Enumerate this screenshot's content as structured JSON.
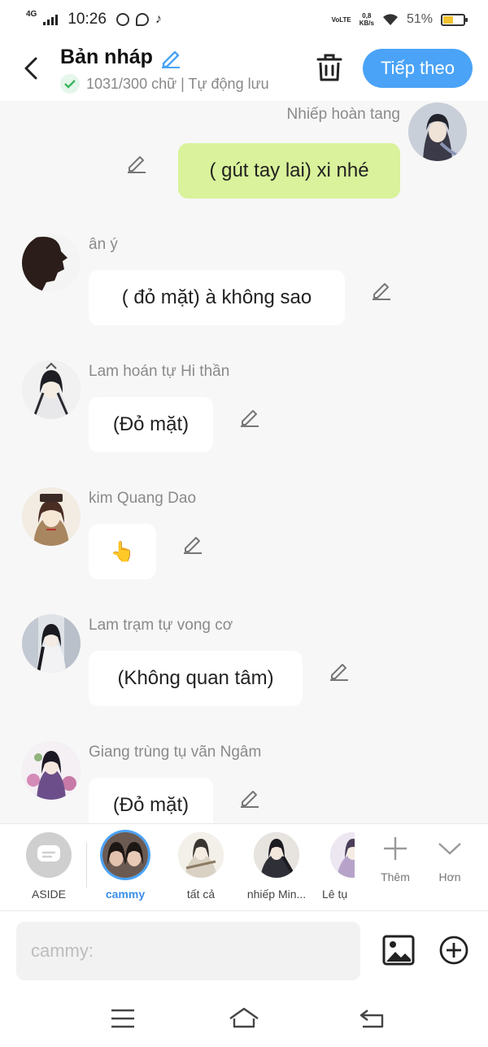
{
  "status_bar": {
    "network": "4G",
    "time": "10:26",
    "volte": "VoLTE",
    "speed_value": "0,8",
    "speed_unit": "KB/s",
    "battery": "51%",
    "battery_level": 0.51
  },
  "header": {
    "title": "Bản nháp",
    "subtitle": "1031/300 chữ | Tự động lưu",
    "next_label": "Tiếp theo"
  },
  "messages": [
    {
      "sender": "Nhiếp hoàn tang",
      "text": "( gút tay lai) xi nhé",
      "mine": true
    },
    {
      "sender": "ân ý",
      "text": "( đỏ mặt) à không sao",
      "mine": false
    },
    {
      "sender": "Lam hoán tự Hi thần",
      "text": "(Đỏ mặt)",
      "mine": false
    },
    {
      "sender": "kim Quang Dao",
      "text": "👆",
      "mine": false
    },
    {
      "sender": "Lam trạm tự vong cơ",
      "text": "(Không quan tâm)",
      "mine": false
    },
    {
      "sender": "Giang trùng tụ vãn Ngâm",
      "text": "(Đỏ mặt)",
      "mine": false
    }
  ],
  "characters": [
    {
      "label": "ASIDE"
    },
    {
      "label": "cammy",
      "active": true
    },
    {
      "label": "tất cả"
    },
    {
      "label": "nhiếp Min..."
    },
    {
      "label": "Lê tụ"
    }
  ],
  "tools": {
    "add_label": "Thêm",
    "more_label": "Hơn"
  },
  "input": {
    "placeholder": "cammy:"
  },
  "colors": {
    "accent": "#4aa3f7",
    "my_bubble": "#d9f29b",
    "background": "#f7f7f7"
  }
}
